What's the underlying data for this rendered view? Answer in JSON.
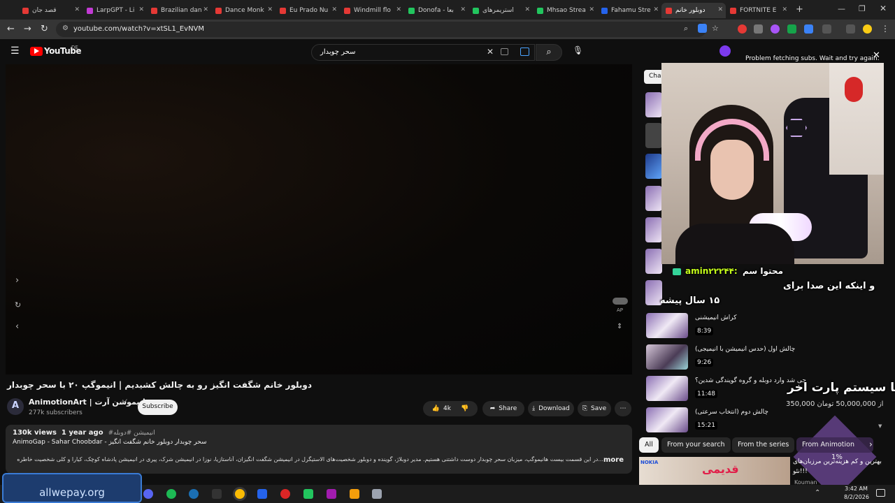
{
  "browser": {
    "tabs": [
      {
        "label": "قصد جان",
        "color": "#e53935"
      },
      {
        "label": "LarpGPT - Li",
        "color": "#c23bd4"
      },
      {
        "label": "Brazilian dan",
        "color": "#e53935"
      },
      {
        "label": "Dance Monk",
        "color": "#e53935"
      },
      {
        "label": "Eu Prado Nu",
        "color": "#e53935"
      },
      {
        "label": "Windmill flo",
        "color": "#e53935"
      },
      {
        "label": "Donofa - بعا",
        "color": "#22c55e"
      },
      {
        "label": "استریمرهای",
        "color": "#22c55e"
      },
      {
        "label": "Mhsao Strea",
        "color": "#22c55e"
      },
      {
        "label": "Fahamu Stre",
        "color": "#2563eb"
      },
      {
        "label": "دوبلور خانم",
        "color": "#e53935"
      },
      {
        "label": "FORTNITE E",
        "color": "#e53935"
      }
    ],
    "url": "youtube.com/watch?v=xtSL1_EvNVM"
  },
  "youtube": {
    "logo_text": "YouTube",
    "region": "DE",
    "search_value": "سحر چوبدار"
  },
  "video": {
    "title": "دوبلور خانم شگفت انگیز رو به چالش کشیدیم | انیموگپ ۲۰ با سحر چوبدار",
    "channel_name": "AnimotionArt | انیموشن آرت",
    "subscribers": "277k subscribers",
    "subscribe_label": "Subscribe",
    "likes": "4k",
    "share_label": "Share",
    "download_label": "Download",
    "save_label": "Save",
    "player_ap_label": "AP"
  },
  "description": {
    "views": "130k views",
    "age": "1 year ago",
    "hashtags": "#انیمیشن #دوبله",
    "line1": "AnimoGap - Sahar Choobdar - سحر چوبدار دوبلور خانم شگفت انگیز",
    "line2": "...در این قسمت بیست هانیموگپ، میزبان سحر چوبدار دوست داشتنی هستیم. مدیر دوبلاژ، گوینده و دوبلور شخصیت‌های الاستیگرل در انیمیشن شگفت انگیزان، آناستازیا، نوزا در انیمیشن شرک، پیری در انیمیشن پادشاه کوچک، کیارا و کلی شخصیت خاطره",
    "more_label": "more"
  },
  "sidebar": {
    "chat_label": "Cha",
    "items": [
      {
        "title": "کراش انیمیشنی",
        "duration": "8:39"
      },
      {
        "title": "چالش اول (حدس انیمیشن با انیمیجی)",
        "duration": "9:26"
      },
      {
        "title": "چی شد وارد دوبله و گروه گویندگی شدین؟",
        "duration": "11:48"
      },
      {
        "title": "چالش دوم (انتخاب سرعتی)",
        "duration": "15:21"
      }
    ]
  },
  "chips": {
    "all": "All",
    "from_search": "From your search",
    "from_series": "From the series",
    "from_animotion": "From Animotion"
  },
  "overlay": {
    "subs_error": "Problem fetching subs. Wait and try again.",
    "chat_user": "amin۲۲۲۴۴:",
    "chat_msg_1": "محتوا سم",
    "chat_msg_2": "و اینکه این صدا برای",
    "chat_msg_3": "۱۵ سال پیشه",
    "goal_title": "ارتقا سیستم پارت اخر",
    "goal_progress": "350,000 از 50,000,000 تومان",
    "goal_percent": "1%",
    "promo_text": "بهترین و کم هزینه‌ترین مرزبان‌های",
    "promo_text_2": "نئو!!!",
    "promo_brand": "Kouman",
    "promo_label": "قدیمی",
    "promo_nokia": "NOKIA",
    "allwepay": "allwepay.org"
  },
  "taskbar": {
    "time": "3:42 AM",
    "date": "8/2/2026"
  }
}
